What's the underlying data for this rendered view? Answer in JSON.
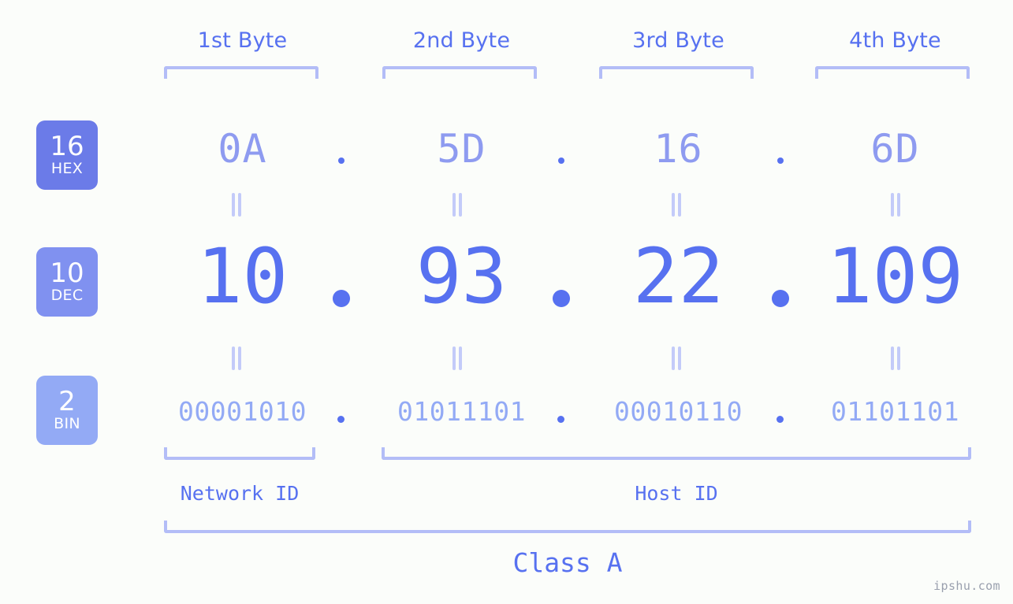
{
  "colors": {
    "background": "#fbfdfa",
    "accent_strong": "#5771f0",
    "accent_hex": "#8e9bf0",
    "accent_bin": "#93aaf5",
    "bracket": "#b3bdf7",
    "connector": "#c3cbf9",
    "badge_hex": "#6b7be8",
    "badge_dec": "#8091f0",
    "badge_bin": "#93aaf5",
    "watermark": "#9aa0ae"
  },
  "headers": [
    {
      "label": "1st Byte"
    },
    {
      "label": "2nd Byte"
    },
    {
      "label": "3rd Byte"
    },
    {
      "label": "4th Byte"
    }
  ],
  "bases": [
    {
      "number": "16",
      "name": "HEX"
    },
    {
      "number": "10",
      "name": "DEC"
    },
    {
      "number": "2",
      "name": "BIN"
    }
  ],
  "separator": ".",
  "rows": {
    "hex": {
      "base_number": "16",
      "base_name": "HEX",
      "values": [
        "0A",
        "5D",
        "16",
        "6D"
      ]
    },
    "dec": {
      "base_number": "10",
      "base_name": "DEC",
      "values": [
        "10",
        "93",
        "22",
        "109"
      ]
    },
    "bin": {
      "base_number": "2",
      "base_name": "BIN",
      "values": [
        "00001010",
        "01011101",
        "00010110",
        "01101101"
      ]
    }
  },
  "connectors": {
    "glyph": "="
  },
  "spans": [
    {
      "label": "Network ID"
    },
    {
      "label": "Host ID"
    }
  ],
  "class": {
    "label": "Class A"
  },
  "watermark": {
    "text": "ipshu.com"
  },
  "chart_data": {
    "type": "table",
    "title": "IP address byte breakdown",
    "ip_decimal": "10.93.22.109",
    "ip_hex": "0A.5D.16.6D",
    "ip_binary": "00001010.01011101.00010110.01101101",
    "ip_class": "Class A",
    "columns": [
      "1st Byte",
      "2nd Byte",
      "3rd Byte",
      "4th Byte"
    ],
    "rows": [
      {
        "base": 16,
        "base_name": "HEX",
        "values": [
          "0A",
          "5D",
          "16",
          "6D"
        ]
      },
      {
        "base": 10,
        "base_name": "DEC",
        "values": [
          "10",
          "93",
          "22",
          "109"
        ]
      },
      {
        "base": 2,
        "base_name": "BIN",
        "values": [
          "00001010",
          "01011101",
          "00010110",
          "01101101"
        ]
      }
    ],
    "spans": [
      {
        "label": "Network ID",
        "bytes": [
          1
        ]
      },
      {
        "label": "Host ID",
        "bytes": [
          2,
          3,
          4
        ]
      },
      {
        "label": "Class A",
        "bytes": [
          1,
          2,
          3,
          4
        ]
      }
    ]
  }
}
